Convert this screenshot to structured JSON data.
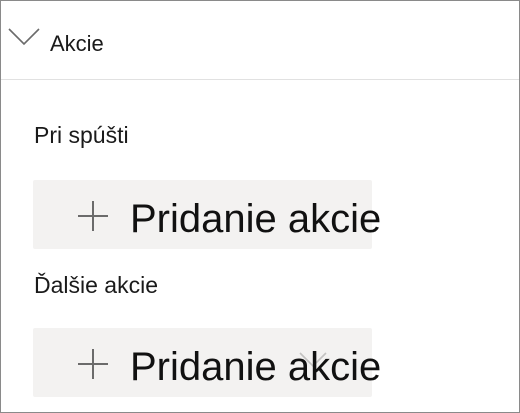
{
  "panel": {
    "header": {
      "label": "Akcie",
      "icon": "chevron-down-icon"
    },
    "sections": [
      {
        "label": "Pri spúšti",
        "button_label": "Pridanie akcie",
        "button_icon": "plus-icon"
      },
      {
        "label": "Ďalšie akcie",
        "button_label": "Pridanie akcie",
        "button_icon": "plus-icon"
      }
    ]
  },
  "colors": {
    "border": "#8a8a8a",
    "divider": "#e1e1e1",
    "button_bg": "#f3f2f1",
    "icon_stroke": "#6b6b6b",
    "text": "#1a1a1a"
  }
}
